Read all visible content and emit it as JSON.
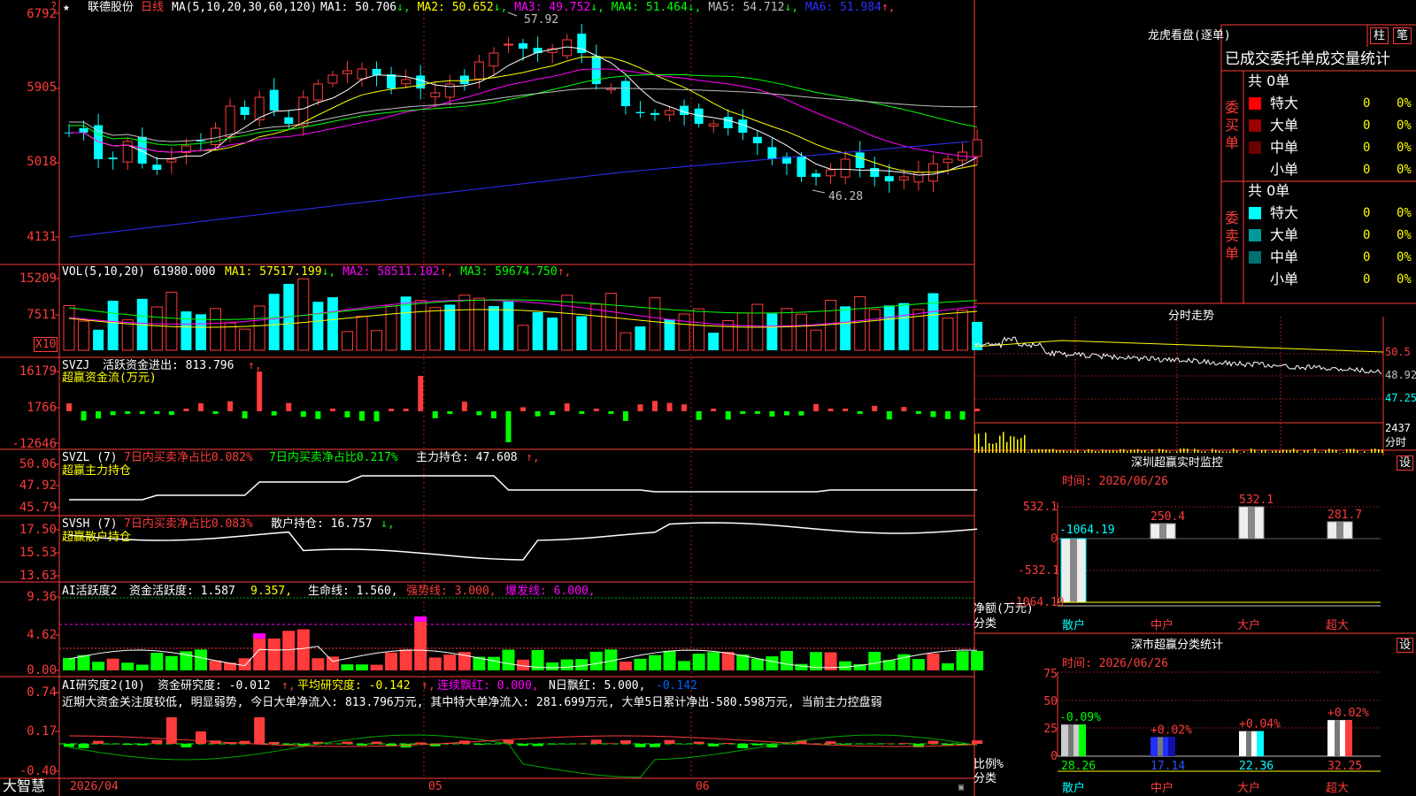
{
  "stock": {
    "name": "联德股份",
    "period": "日线",
    "star": "★",
    "question": "?"
  },
  "main_panel": {
    "legend_params": "MA(5,10,20,30,60,120)",
    "ma": [
      {
        "label": "MA1: 50.706",
        "arrow": "↓",
        "color": "#ffffff"
      },
      {
        "label": "MA2: 50.652",
        "arrow": "↓",
        "color": "#ffff00"
      },
      {
        "label": "MA3: 49.752",
        "arrow": "↓",
        "color": "#ff00ff"
      },
      {
        "label": "MA4: 51.464",
        "arrow": "↓",
        "color": "#00ff00"
      },
      {
        "label": "MA5: 54.712",
        "arrow": "↓",
        "color": "#c0c0c0"
      },
      {
        "label": "MA6: 51.984",
        "arrow": "↑",
        "color": "#3030ff"
      }
    ],
    "y_ticks": [
      "6792",
      "5905",
      "5018",
      "4131"
    ],
    "high_label": "57.92",
    "low_label": "46.28"
  },
  "vol_panel": {
    "legend_name": "VOL(5,10,20)",
    "legend_value": "61980.000",
    "ma": [
      {
        "label": "MA1: 57517.199",
        "arrow": "↓",
        "color": "#ffff00"
      },
      {
        "label": "MA2: 58511.102",
        "arrow": "↑",
        "color": "#ff00ff"
      },
      {
        "label": "MA3: 59674.750",
        "arrow": "↑",
        "color": "#00ff00"
      }
    ],
    "y_ticks": [
      "15209",
      "7511"
    ],
    "unit": "X10"
  },
  "svzj_panel": {
    "name": "SVZJ",
    "legend": "活跃资金进出: 813.796",
    "subtitle": "超赢资金流(万元)",
    "y_ticks": [
      "16179",
      "1766",
      "-12646"
    ]
  },
  "svzl_panel": {
    "name": "SVZL (7)",
    "item1": "7日内买卖净占比0.082%",
    "item2": "7日内买卖净占比0.217%",
    "item3": "主力持仓: 47.608",
    "subtitle": "超赢主力持仓",
    "y_ticks": [
      "50.06",
      "47.92",
      "45.79"
    ]
  },
  "svsh_panel": {
    "name": "SVSH (7)",
    "item1": "7日内买卖净占比0.083%",
    "item2": "散户持仓: 16.757",
    "subtitle": "超赢散户持仓",
    "y_ticks": [
      "17.50",
      "15.53",
      "13.63"
    ]
  },
  "ai_active_panel": {
    "name": "AI活跃度2",
    "item1": "资金活跃度: 1.587",
    "item2": "9.357,",
    "item3": "生命线: 1.560,",
    "item4": "强势线: 3.000,",
    "item5": "爆发线: 6.000,",
    "y_ticks": [
      "9.36",
      "4.62",
      "0.00"
    ]
  },
  "ai_research_panel": {
    "name": "AI研究度2(10)",
    "item1": "资金研究度: -0.012",
    "item2": "平均研究度: -0.142",
    "item3": "连续飘红: 0.000,",
    "item4": "N日飘红: 5.000,",
    "item5": "-0.142",
    "summary": "近期大资金关注度较低, 明显弱势, 今日大单净流入: 813.796万元, 其中特大单净流入: 281.699万元, 大单5日累计净出-580.598万元, 当前主力控盘弱",
    "y_ticks": [
      "0.74",
      "0.17",
      "-0.40"
    ]
  },
  "bottom_bar": {
    "brand": "大智慧",
    "dates": [
      "2026/04",
      "05",
      "06"
    ]
  },
  "dragon_tiger": {
    "title": "龙虎看盘(逐单)",
    "tab1": "柱",
    "tab2": "笔",
    "subtitle": "已成交委托单成交量统计",
    "buy_label": "委买单",
    "sell_label": "委卖单",
    "buy_total": "共 0单",
    "sell_total": "共 0单",
    "buy_rows": [
      {
        "label": "特大",
        "count": "0",
        "pct": "0%",
        "color": "#ff0000"
      },
      {
        "label": "大单",
        "count": "0",
        "pct": "0%",
        "color": "#9a0000"
      },
      {
        "label": "中单",
        "count": "0",
        "pct": "0%",
        "color": "#6a0000"
      },
      {
        "label": "小单",
        "count": "0",
        "pct": "0%",
        "color": "#000000"
      }
    ],
    "sell_rows": [
      {
        "label": "特大",
        "count": "0",
        "pct": "0%",
        "color": "#00ffff"
      },
      {
        "label": "大单",
        "count": "0",
        "pct": "0%",
        "color": "#009a9a"
      },
      {
        "label": "中单",
        "count": "0",
        "pct": "0%",
        "color": "#007070"
      },
      {
        "label": "小单",
        "count": "0",
        "pct": "0%",
        "color": "#000000"
      }
    ]
  },
  "intraday": {
    "title": "分时走势",
    "prices": [
      "50.5",
      "48.92",
      "47.25"
    ],
    "vol": "2437",
    "vol_unit": "分时"
  },
  "sz_monitor": {
    "title": "深圳超赢实时监控",
    "settings": "设",
    "time": "时间: 2026/06/26",
    "y_ticks": [
      "532.1",
      "0",
      "-532.1",
      "-1064.19"
    ],
    "unit": "净额(万元)",
    "category_label": "分类",
    "categories": [
      "散户",
      "中户",
      "大户",
      "超大"
    ],
    "values": [
      -1064.19,
      250.4,
      532.1,
      281.7
    ],
    "value_labels": [
      "-1064.19",
      "250.4",
      "532.1",
      "281.7"
    ]
  },
  "sz_classify": {
    "title": "深市超赢分类统计",
    "settings": "设",
    "time": "时间: 2026/06/26",
    "y_ticks": [
      "75",
      "50",
      "25",
      "0"
    ],
    "unit": "比例%",
    "category_label": "分类",
    "categories": [
      "散户",
      "中户",
      "大户",
      "超大"
    ],
    "values": [
      28.26,
      17.14,
      22.36,
      32.25
    ],
    "value_labels": [
      "28.26",
      "17.14",
      "22.36",
      "32.25"
    ],
    "changes": [
      "-0.09%",
      "+0.02%",
      "+0.04%",
      "+0.02%"
    ]
  },
  "chart_data": {
    "type": "candlestick",
    "y_range": [
      41.31,
      67.92
    ],
    "high": 57.92,
    "low": 46.28,
    "x_labels": [
      "2026/04",
      "05",
      "06"
    ]
  }
}
